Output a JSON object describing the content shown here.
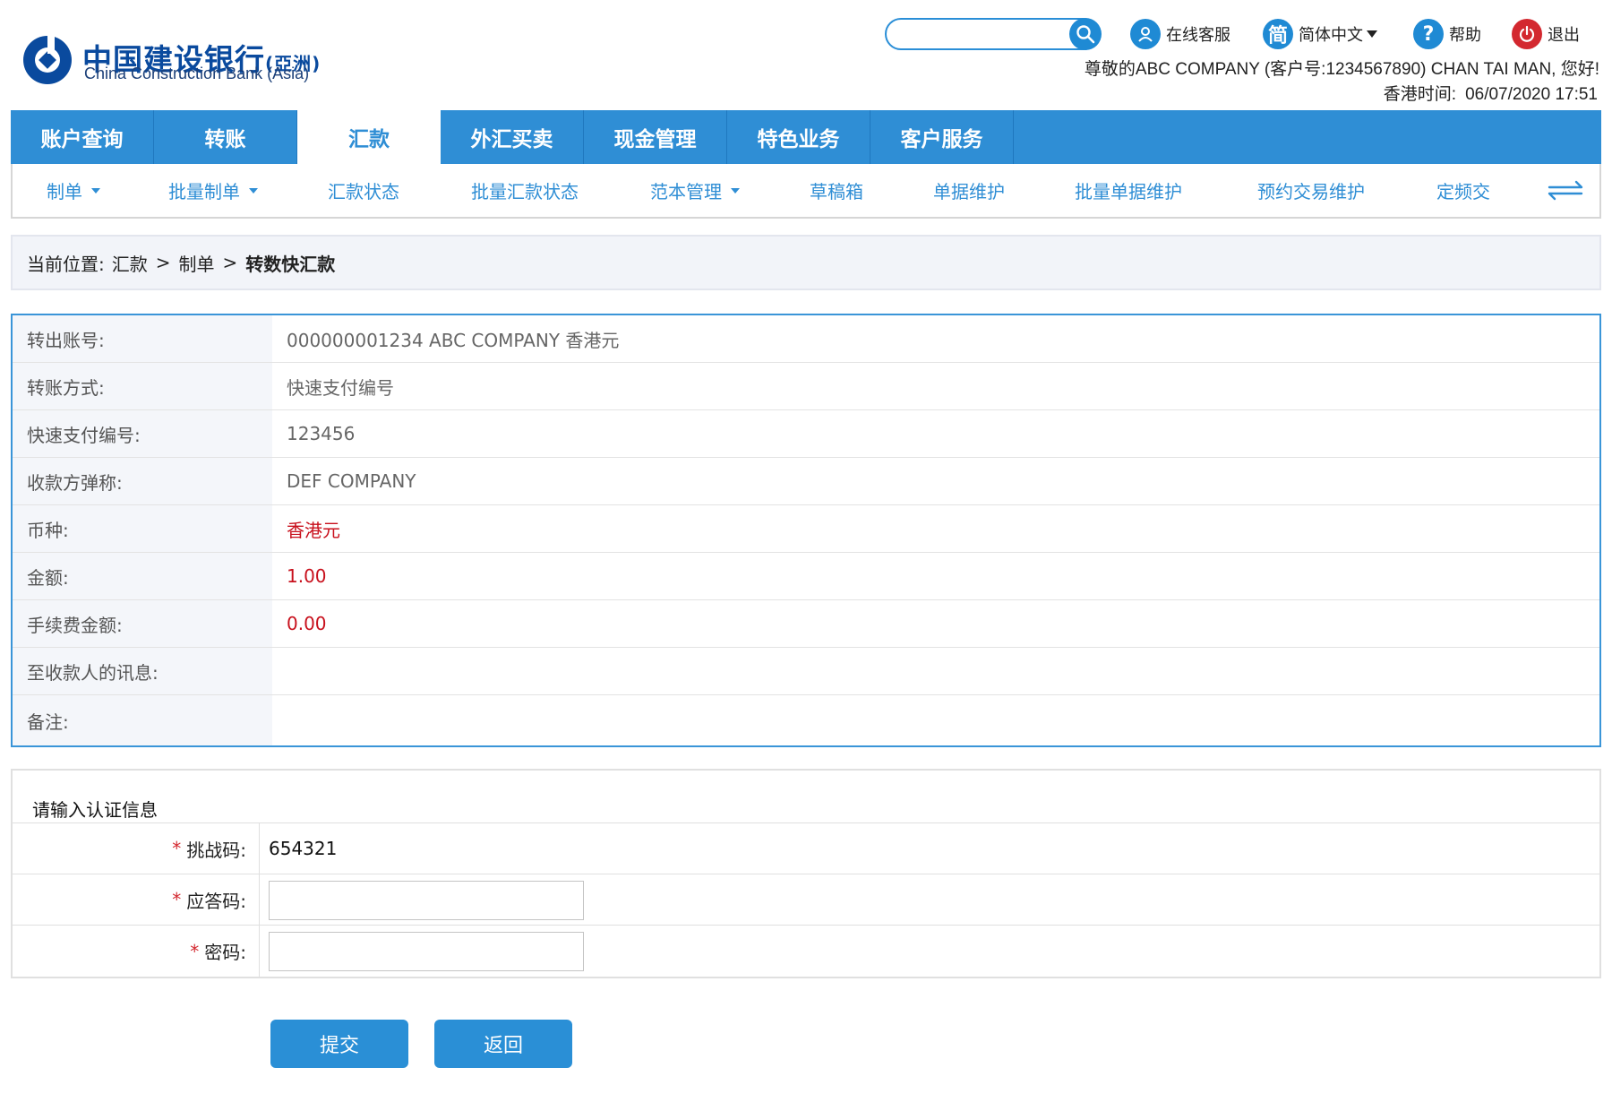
{
  "brand": {
    "name_cn": "中国建设银行",
    "name_cn_suffix": "(亞洲)",
    "name_en": "China Construction Bank (Asia)"
  },
  "header": {
    "search_placeholder": "",
    "service_label": "在线客服",
    "lang_icon_char": "简",
    "lang_label": "简体中文",
    "help_label": "帮助",
    "exit_label": "退出",
    "greeting": "尊敬的ABC COMPANY (客户号:1234567890) CHAN TAI MAN, 您好!",
    "time_label": "香港时间:",
    "time_value": "06/07/2020 17:51"
  },
  "main_nav": [
    "账户查询",
    "转账",
    "汇款",
    "外汇买卖",
    "现金管理",
    "特色业务",
    "客户服务"
  ],
  "main_nav_active": "汇款",
  "sub_nav": [
    {
      "label": "制单",
      "dropdown": true
    },
    {
      "label": "批量制单",
      "dropdown": true
    },
    {
      "label": "汇款状态",
      "dropdown": false
    },
    {
      "label": "批量汇款状态",
      "dropdown": false
    },
    {
      "label": "范本管理",
      "dropdown": true
    },
    {
      "label": "草稿箱",
      "dropdown": false
    },
    {
      "label": "单据维护",
      "dropdown": false
    },
    {
      "label": "批量单据维护",
      "dropdown": false
    },
    {
      "label": "预约交易维护",
      "dropdown": false
    },
    {
      "label": "定频交",
      "dropdown": false
    }
  ],
  "breadcrumb": {
    "prefix": "当前位置:",
    "items": [
      "汇款",
      "制单"
    ],
    "current": "转数快汇款",
    "separator": ">"
  },
  "details": [
    {
      "label": "转出账号:",
      "value": "000000001234 ABC COMPANY 香港元"
    },
    {
      "label": "转账方式:",
      "value": "快速支付编号"
    },
    {
      "label": "快速支付编号:",
      "value": "123456"
    },
    {
      "label": "收款方弹称:",
      "value": "DEF COMPANY"
    },
    {
      "label": "币种:",
      "value": "香港元",
      "highlight": true
    },
    {
      "label": "金额:",
      "value": "1.00",
      "highlight": true
    },
    {
      "label": "手续费金额:",
      "value": "0.00",
      "highlight": true
    },
    {
      "label": "至收款人的讯息:",
      "value": ""
    },
    {
      "label": "备注:",
      "value": ""
    }
  ],
  "auth": {
    "title": "请输入认证信息",
    "required_mark": "*",
    "challenge_label": "挑战码:",
    "challenge_value": "654321",
    "response_label": "应答码:",
    "response_value": "",
    "password_label": "密码:",
    "password_value": ""
  },
  "buttons": {
    "submit": "提交",
    "back": "返回"
  },
  "colors": {
    "primary": "#2f8ed5",
    "highlight_red": "#c8101c",
    "exit_red": "#d3282f"
  }
}
